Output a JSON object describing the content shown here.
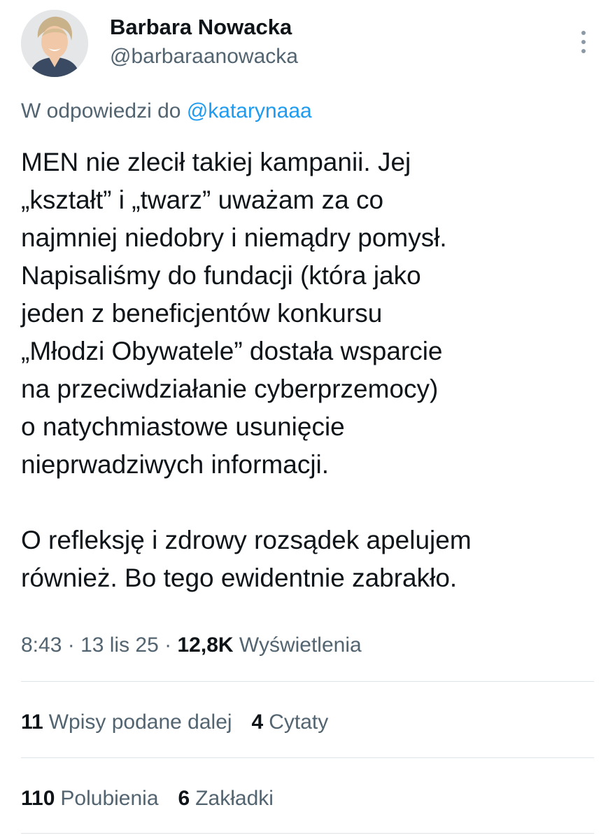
{
  "author": {
    "name": "Barbara Nowacka",
    "handle": "@barbaraanowacka",
    "avatar_icon": "profile-photo"
  },
  "reply_to": {
    "prefix": "W odpowiedzi do",
    "handle": "@katarynaaa"
  },
  "tweet": {
    "paragraph1": "MEN nie zlecił takiej kampanii. Jej\n„kształt” i „twarz” uważam za co\nnajmniej niedobry i niemądry pomysł.\nNapisaliśmy do fundacji (która  jako\njeden z beneficjentów konkursu\n„Młodzi Obywatele” dostała wsparcie\nna przeciwdziałanie cyberprzemocy)\no natychmiastowe usunięcie\nnieprwadziwych informacji.",
    "paragraph2": "O refleksję i zdrowy rozsądek apelujem\nrównież. Bo tego ewidentnie zabrakło."
  },
  "meta": {
    "time": "8:43",
    "separator": " · ",
    "date": "13 lis 25",
    "views_count": "12,8K",
    "views_label": "Wyświetlenia"
  },
  "stats": {
    "retweets_count": "11",
    "retweets_label": "Wpisy podane dalej",
    "quotes_count": "4",
    "quotes_label": "Cytaty",
    "likes_count": "110",
    "likes_label": "Polubienia",
    "bookmarks_count": "6",
    "bookmarks_label": "Zakładki"
  },
  "colors": {
    "text": "#0f1419",
    "secondary": "#536471",
    "link": "#1d9bf0",
    "divider": "#dde3e7"
  }
}
